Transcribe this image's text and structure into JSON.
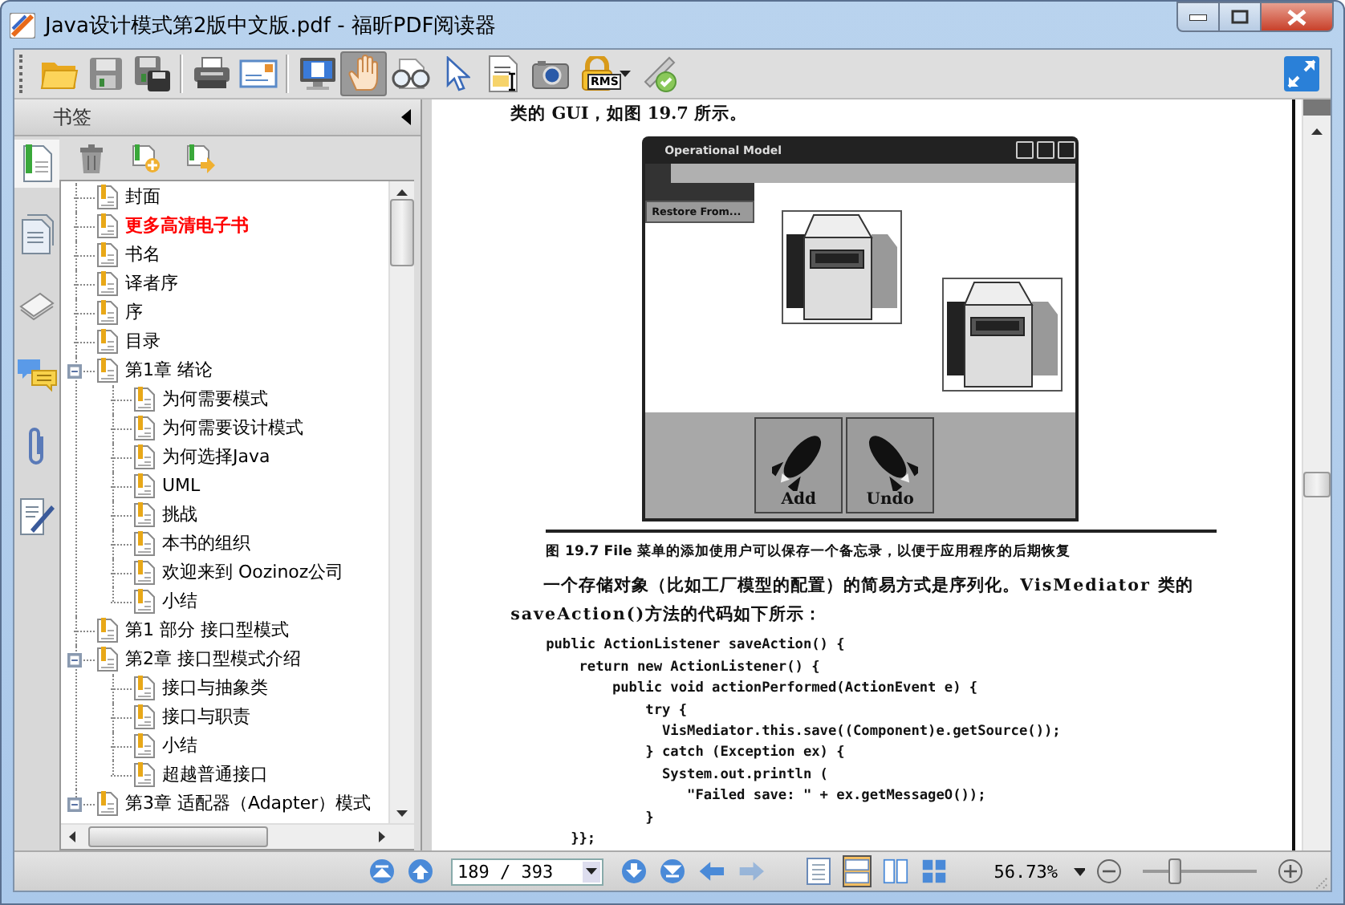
{
  "window": {
    "title": "Java设计模式第2版中文版.pdf - 福昕PDF阅读器"
  },
  "toolbar": {
    "tools": [
      {
        "kind": "open",
        "selected": false
      },
      {
        "kind": "save",
        "selected": false
      },
      {
        "kind": "saveas",
        "selected": false
      },
      {
        "kind": "separator"
      },
      {
        "kind": "print",
        "selected": false
      },
      {
        "kind": "email",
        "selected": false
      },
      {
        "kind": "separator"
      },
      {
        "kind": "monitor",
        "selected": false
      },
      {
        "kind": "hand",
        "selected": true
      },
      {
        "kind": "glasses",
        "selected": false
      },
      {
        "kind": "pointer",
        "selected": false
      },
      {
        "kind": "textselect",
        "selected": false
      },
      {
        "kind": "camera",
        "selected": false
      },
      {
        "kind": "lock",
        "label": "RMS",
        "selected": false,
        "has_menu": true
      },
      {
        "kind": "sign",
        "selected": false
      }
    ],
    "right_tools": [
      {
        "kind": "expand",
        "selected": false
      }
    ]
  },
  "bookmarks_panel": {
    "title": "书签",
    "side_tabs": [
      {
        "kind": "bookmarks",
        "selected": true
      },
      {
        "kind": "pages",
        "selected": false
      },
      {
        "kind": "layers",
        "selected": false
      },
      {
        "kind": "comments",
        "selected": false
      },
      {
        "kind": "attachment",
        "selected": false
      },
      {
        "kind": "signature",
        "selected": false
      }
    ],
    "tools": [
      {
        "kind": "delete"
      },
      {
        "kind": "add"
      },
      {
        "kind": "move"
      }
    ],
    "tree": [
      {
        "label": "封面",
        "color": "#000000"
      },
      {
        "label": "更多高清电子书",
        "color": "#ff0000",
        "bold": true
      },
      {
        "label": "书名",
        "color": "#000000"
      },
      {
        "label": "译者序",
        "color": "#000000"
      },
      {
        "label": "序",
        "color": "#000000"
      },
      {
        "label": "目录",
        "color": "#000000"
      },
      {
        "label": "第1章 绪论",
        "color": "#000000",
        "expanded": true,
        "children": [
          {
            "label": "为何需要模式",
            "color": "#000000"
          },
          {
            "label": "为何需要设计模式",
            "color": "#000000"
          },
          {
            "label": "为何选择Java",
            "color": "#000000"
          },
          {
            "label": "UML",
            "color": "#000000"
          },
          {
            "label": "挑战",
            "color": "#000000"
          },
          {
            "label": "本书的组织",
            "color": "#000000"
          },
          {
            "label": "欢迎来到 Oozinoz公司",
            "color": "#000000"
          },
          {
            "label": "小结",
            "color": "#000000"
          }
        ]
      },
      {
        "label": "第1 部分 接口型模式",
        "color": "#000000"
      },
      {
        "label": "第2章 接口型模式介绍",
        "color": "#000000",
        "expanded": true,
        "children": [
          {
            "label": "接口与抽象类",
            "color": "#000000"
          },
          {
            "label": "接口与职责",
            "color": "#000000"
          },
          {
            "label": "小结",
            "color": "#000000"
          },
          {
            "label": "超越普通接口",
            "color": "#000000"
          }
        ]
      },
      {
        "label": "第3章 适配器（Adapter）模式",
        "color": "#000000",
        "expanded": true
      }
    ]
  },
  "document": {
    "intro": "类的 GUI，如图 19.7 所示。",
    "figure": {
      "title": "Operational Model",
      "menu_item": "Restore From...",
      "buttons": [
        {
          "label": "Add",
          "kind": "rocket-up"
        },
        {
          "label": "Undo",
          "kind": "rocket-down"
        }
      ]
    },
    "caption": "图 19.7  File 菜单的添加使用户可以保存一个备忘录，以便于应用程序的后期恢复",
    "paragraph": "一个存储对象（比如工厂模型的配置）的简易方式是序列化。VisMediator 类的saveAction()方法的代码如下所示：",
    "code": [
      "public ActionListener saveAction() {",
      "    return new ActionListener() {",
      "        public void actionPerformed(ActionEvent e) {",
      "            try {",
      "              VisMediator.this.save((Component)e.getSource());",
      "            } catch (Exception ex) {",
      "              System.out.println (",
      "                 \"Failed save: \" + ex.getMessageO());",
      "            }",
      "   }};"
    ]
  },
  "status_bar": {
    "nav": [
      {
        "kind": "first",
        "disabled": false
      },
      {
        "kind": "prev",
        "disabled": false
      }
    ],
    "page": "189 / 393",
    "nav_after": [
      {
        "kind": "next",
        "disabled": false
      },
      {
        "kind": "last",
        "disabled": false
      },
      {
        "kind": "back",
        "disabled": false
      },
      {
        "kind": "forward",
        "disabled": true
      }
    ],
    "view_modes": [
      {
        "kind": "single",
        "selected": false
      },
      {
        "kind": "continuous",
        "selected": true
      },
      {
        "kind": "facing",
        "selected": false
      },
      {
        "kind": "continuous-facing",
        "selected": false
      }
    ],
    "zoom": "56.73%",
    "zoom_slider": {
      "level": 0.28
    }
  }
}
